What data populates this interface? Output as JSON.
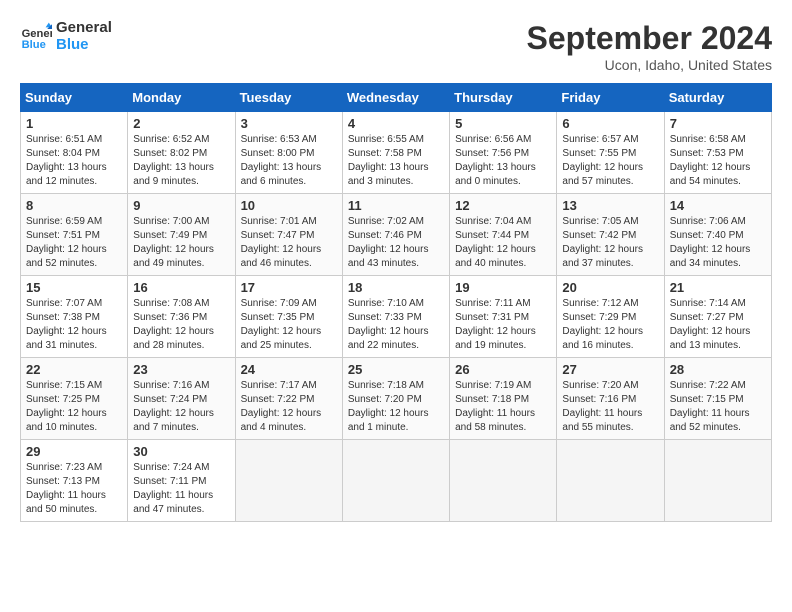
{
  "logo": {
    "line1": "General",
    "line2": "Blue"
  },
  "title": "September 2024",
  "location": "Ucon, Idaho, United States",
  "days_of_week": [
    "Sunday",
    "Monday",
    "Tuesday",
    "Wednesday",
    "Thursday",
    "Friday",
    "Saturday"
  ],
  "weeks": [
    [
      {
        "day": "1",
        "sunrise": "6:51 AM",
        "sunset": "8:04 PM",
        "daylight": "13 hours and 12 minutes."
      },
      {
        "day": "2",
        "sunrise": "6:52 AM",
        "sunset": "8:02 PM",
        "daylight": "13 hours and 9 minutes."
      },
      {
        "day": "3",
        "sunrise": "6:53 AM",
        "sunset": "8:00 PM",
        "daylight": "13 hours and 6 minutes."
      },
      {
        "day": "4",
        "sunrise": "6:55 AM",
        "sunset": "7:58 PM",
        "daylight": "13 hours and 3 minutes."
      },
      {
        "day": "5",
        "sunrise": "6:56 AM",
        "sunset": "7:56 PM",
        "daylight": "13 hours and 0 minutes."
      },
      {
        "day": "6",
        "sunrise": "6:57 AM",
        "sunset": "7:55 PM",
        "daylight": "12 hours and 57 minutes."
      },
      {
        "day": "7",
        "sunrise": "6:58 AM",
        "sunset": "7:53 PM",
        "daylight": "12 hours and 54 minutes."
      }
    ],
    [
      {
        "day": "8",
        "sunrise": "6:59 AM",
        "sunset": "7:51 PM",
        "daylight": "12 hours and 52 minutes."
      },
      {
        "day": "9",
        "sunrise": "7:00 AM",
        "sunset": "7:49 PM",
        "daylight": "12 hours and 49 minutes."
      },
      {
        "day": "10",
        "sunrise": "7:01 AM",
        "sunset": "7:47 PM",
        "daylight": "12 hours and 46 minutes."
      },
      {
        "day": "11",
        "sunrise": "7:02 AM",
        "sunset": "7:46 PM",
        "daylight": "12 hours and 43 minutes."
      },
      {
        "day": "12",
        "sunrise": "7:04 AM",
        "sunset": "7:44 PM",
        "daylight": "12 hours and 40 minutes."
      },
      {
        "day": "13",
        "sunrise": "7:05 AM",
        "sunset": "7:42 PM",
        "daylight": "12 hours and 37 minutes."
      },
      {
        "day": "14",
        "sunrise": "7:06 AM",
        "sunset": "7:40 PM",
        "daylight": "12 hours and 34 minutes."
      }
    ],
    [
      {
        "day": "15",
        "sunrise": "7:07 AM",
        "sunset": "7:38 PM",
        "daylight": "12 hours and 31 minutes."
      },
      {
        "day": "16",
        "sunrise": "7:08 AM",
        "sunset": "7:36 PM",
        "daylight": "12 hours and 28 minutes."
      },
      {
        "day": "17",
        "sunrise": "7:09 AM",
        "sunset": "7:35 PM",
        "daylight": "12 hours and 25 minutes."
      },
      {
        "day": "18",
        "sunrise": "7:10 AM",
        "sunset": "7:33 PM",
        "daylight": "12 hours and 22 minutes."
      },
      {
        "day": "19",
        "sunrise": "7:11 AM",
        "sunset": "7:31 PM",
        "daylight": "12 hours and 19 minutes."
      },
      {
        "day": "20",
        "sunrise": "7:12 AM",
        "sunset": "7:29 PM",
        "daylight": "12 hours and 16 minutes."
      },
      {
        "day": "21",
        "sunrise": "7:14 AM",
        "sunset": "7:27 PM",
        "daylight": "12 hours and 13 minutes."
      }
    ],
    [
      {
        "day": "22",
        "sunrise": "7:15 AM",
        "sunset": "7:25 PM",
        "daylight": "12 hours and 10 minutes."
      },
      {
        "day": "23",
        "sunrise": "7:16 AM",
        "sunset": "7:24 PM",
        "daylight": "12 hours and 7 minutes."
      },
      {
        "day": "24",
        "sunrise": "7:17 AM",
        "sunset": "7:22 PM",
        "daylight": "12 hours and 4 minutes."
      },
      {
        "day": "25",
        "sunrise": "7:18 AM",
        "sunset": "7:20 PM",
        "daylight": "12 hours and 1 minute."
      },
      {
        "day": "26",
        "sunrise": "7:19 AM",
        "sunset": "7:18 PM",
        "daylight": "11 hours and 58 minutes."
      },
      {
        "day": "27",
        "sunrise": "7:20 AM",
        "sunset": "7:16 PM",
        "daylight": "11 hours and 55 minutes."
      },
      {
        "day": "28",
        "sunrise": "7:22 AM",
        "sunset": "7:15 PM",
        "daylight": "11 hours and 52 minutes."
      }
    ],
    [
      {
        "day": "29",
        "sunrise": "7:23 AM",
        "sunset": "7:13 PM",
        "daylight": "11 hours and 50 minutes."
      },
      {
        "day": "30",
        "sunrise": "7:24 AM",
        "sunset": "7:11 PM",
        "daylight": "11 hours and 47 minutes."
      },
      null,
      null,
      null,
      null,
      null
    ]
  ]
}
